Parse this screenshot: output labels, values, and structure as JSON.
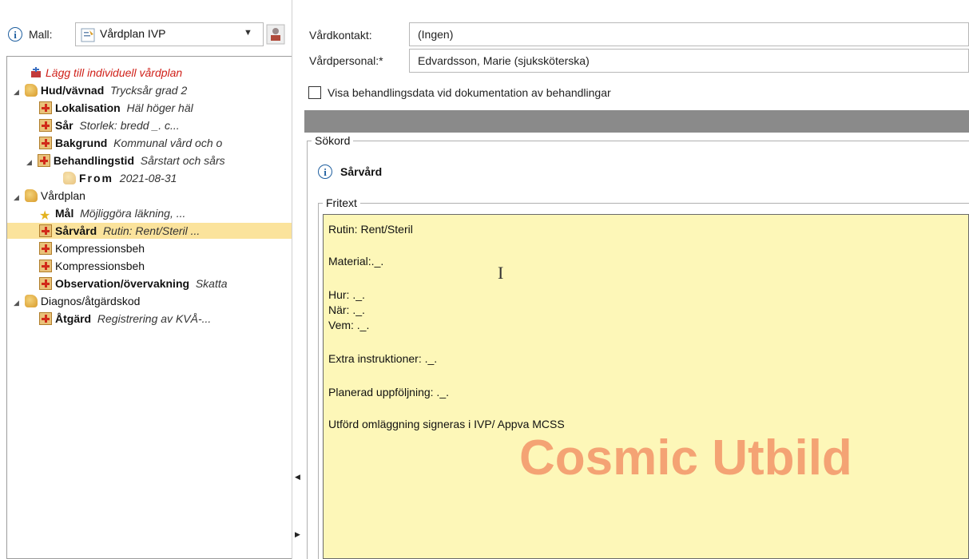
{
  "mall": {
    "label": "Mall:",
    "selected": "Vårdplan IVP"
  },
  "tree": {
    "add_plan": "Lägg till individuell vårdplan",
    "items": [
      {
        "title": "Hud/vävnad",
        "detail": "Trycksår grad 2"
      },
      {
        "title": "Lokalisation",
        "detail": "Häl höger häl"
      },
      {
        "title": "Sår",
        "detail": "Storlek: bredd _. c..."
      },
      {
        "title": "Bakgrund",
        "detail": "Kommunal vård och o"
      },
      {
        "title": "Behandlingstid",
        "detail": "Sårstart och sårs"
      },
      {
        "title": "From",
        "detail": "2021-08-31"
      },
      {
        "title": "Vårdplan",
        "detail": ""
      },
      {
        "title": "Mål",
        "detail": "Möjliggöra läkning, ..."
      },
      {
        "title": "Sårvård",
        "detail": "Rutin: Rent/Steril ..."
      },
      {
        "title": "Kompressionsbeh",
        "detail": ""
      },
      {
        "title": "Kompressionsbeh",
        "detail": ""
      },
      {
        "title": "Observation/övervakning",
        "detail": "Skatta"
      },
      {
        "title": "Diagnos/åtgärdskod",
        "detail": ""
      },
      {
        "title": "Åtgärd",
        "detail": "Registrering av KVÅ-..."
      }
    ]
  },
  "form": {
    "vardkontakt_label": "Vårdkontakt:",
    "vardkontakt_value": "(Ingen)",
    "vardpersonal_label": "Vårdpersonal:*",
    "vardpersonal_value": "Edvardsson, Marie (sjuksköterska)",
    "checkbox_label": "Visa behandlingsdata vid dokumentation av behandlingar",
    "checkbox_checked": false
  },
  "sokord": {
    "legend": "Sökord",
    "term": "Sårvård"
  },
  "fritext": {
    "legend": "Fritext",
    "lines": [
      "Rutin: Rent/Steril",
      "Material:._.",
      "Hur: ._.",
      "När: ._.",
      "Vem: ._.",
      "Extra instruktioner: ._.",
      "Planerad uppföljning: ._.",
      "Utförd omläggning signeras i IVP/ Appva MCSS"
    ]
  },
  "watermark": "Cosmic Utbild"
}
